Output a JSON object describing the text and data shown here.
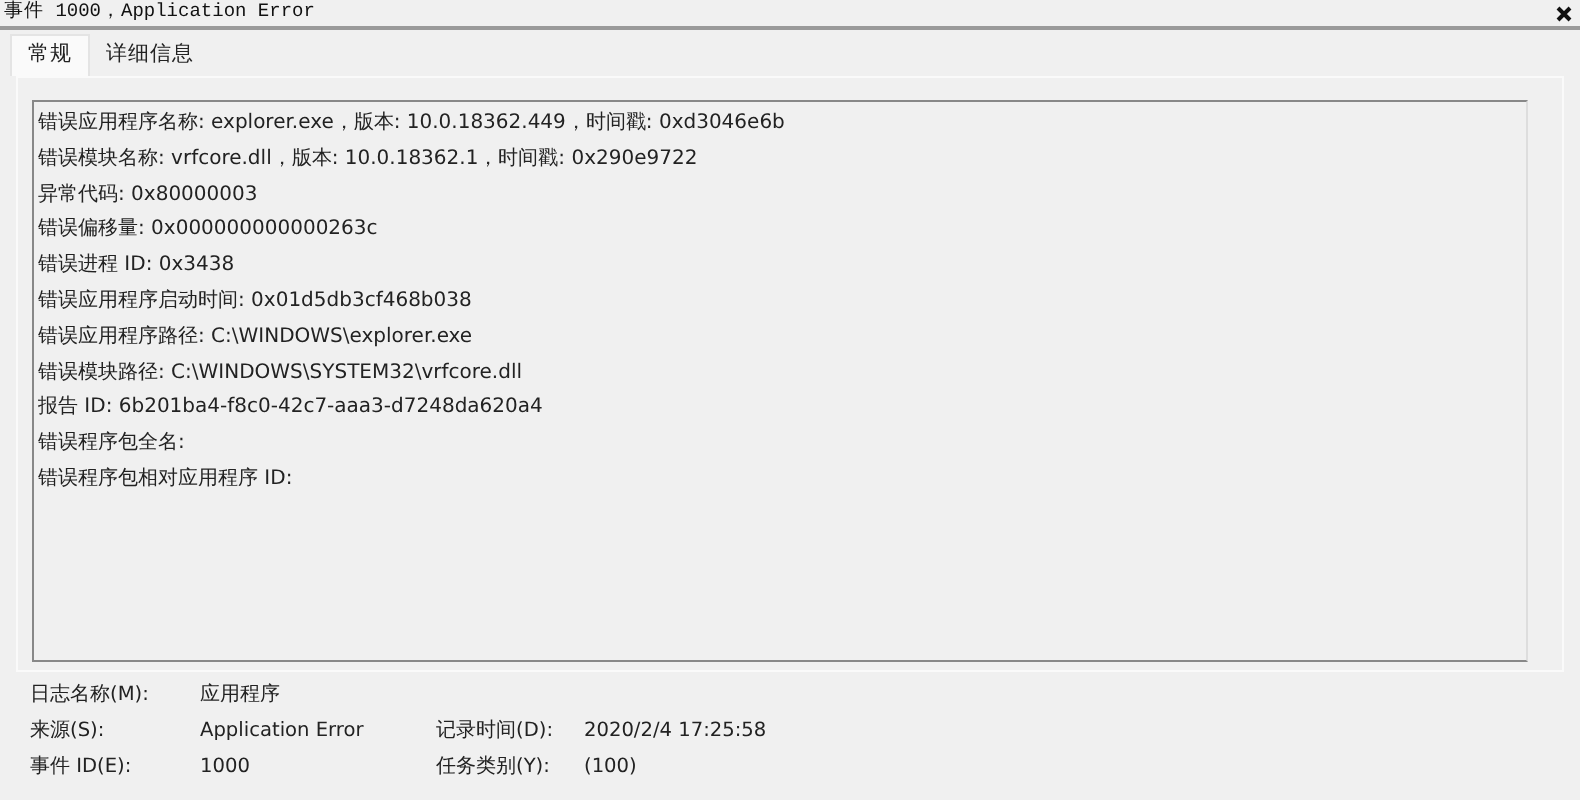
{
  "window": {
    "title": "事件 1000，Application Error"
  },
  "tabs": [
    {
      "label": "常规",
      "selected": true
    },
    {
      "label": "详细信息",
      "selected": false
    }
  ],
  "message_lines": [
    "错误应用程序名称: explorer.exe，版本: 10.0.18362.449，时间戳: 0xd3046e6b",
    "错误模块名称: vrfcore.dll，版本: 10.0.18362.1，时间戳: 0x290e9722",
    "异常代码: 0x80000003",
    "错误偏移量: 0x000000000000263c",
    "错误进程 ID: 0x3438",
    "错误应用程序启动时间: 0x01d5db3cf468b038",
    "错误应用程序路径: C:\\WINDOWS\\explorer.exe",
    "错误模块路径: C:\\WINDOWS\\SYSTEM32\\vrfcore.dll",
    "报告 ID: 6b201ba4-f8c0-42c7-aaa3-d7248da620a4",
    "错误程序包全名:",
    "错误程序包相对应用程序 ID:"
  ],
  "properties": [
    [
      {
        "label": "日志名称(M):",
        "value": "应用程序"
      }
    ],
    [
      {
        "label": "来源(S):",
        "value": "Application Error"
      },
      {
        "label": "记录时间(D):",
        "value": "2020/2/4 17:25:58"
      }
    ],
    [
      {
        "label": "事件 ID(E):",
        "value": "1000"
      },
      {
        "label": "任务类别(Y):",
        "value": "(100)"
      }
    ]
  ]
}
